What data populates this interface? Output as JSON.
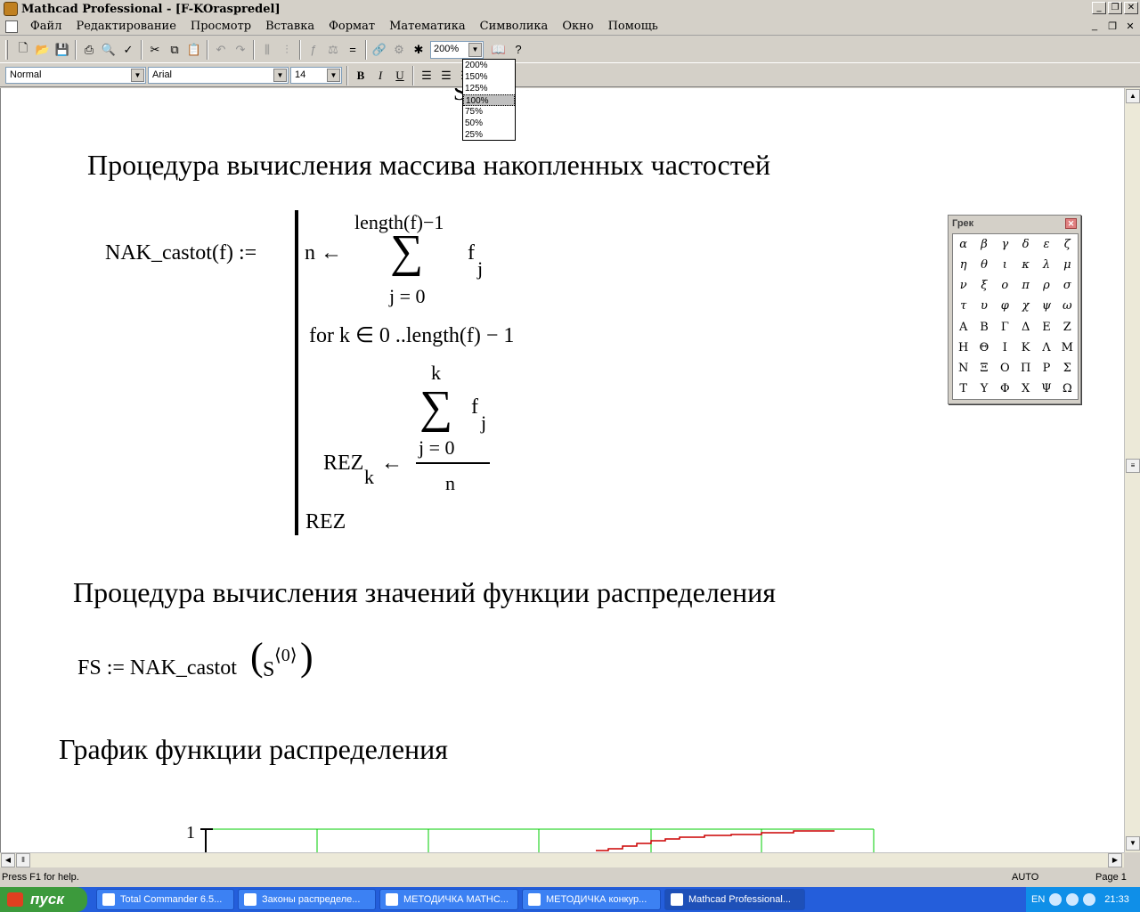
{
  "window": {
    "title": "Mathcad Professional - [F-KOraspredel]"
  },
  "menu": [
    "Файл",
    "Редактирование",
    "Просмотр",
    "Вставка",
    "Формат",
    "Математика",
    "Символика",
    "Окно",
    "Помощь"
  ],
  "toolbar": {
    "zoom_value": "200%"
  },
  "format": {
    "style": "Normal",
    "font": "Arial",
    "size": "14"
  },
  "zoom_options": [
    "200%",
    "150%",
    "125%",
    "100%",
    "75%",
    "50%",
    "25%"
  ],
  "zoom_highlighted": "100%",
  "sheet": {
    "header1": "Процедура вычисления массива накопленных частостей",
    "def_lhs": "NAK_castot(f) :=",
    "n_arrow": "n ←",
    "sum1_upper": "length(f)−1",
    "sum_symbol": "∑",
    "sum1_lower": "j = 0",
    "f_var": "f",
    "j_sub": "j",
    "for_line": "for  k ∈ 0 ..length(f) − 1",
    "sum2_upper": "k",
    "sum2_lower": "j = 0",
    "rez_lhs": "REZ",
    "k_sub": "k",
    "left_arrow": "←",
    "denominator": "n",
    "rez_last": "REZ",
    "header2": "Процедура вычисления  значений функции распределения",
    "fs_lhs": "FS := NAK_castot",
    "fs_arg": "S",
    "fs_sup": "⟨0⟩",
    "header3": "График функции распределения",
    "graph_ytick": "1"
  },
  "greek_palette": {
    "title": "Грек",
    "letters": [
      "α",
      "β",
      "γ",
      "δ",
      "ε",
      "ζ",
      "η",
      "θ",
      "ι",
      "κ",
      "λ",
      "μ",
      "ν",
      "ξ",
      "ο",
      "π",
      "ρ",
      "σ",
      "τ",
      "υ",
      "φ",
      "χ",
      "ψ",
      "ω",
      "Α",
      "Β",
      "Γ",
      "Δ",
      "Ε",
      "Ζ",
      "Η",
      "Θ",
      "Ι",
      "Κ",
      "Λ",
      "Μ",
      "Ν",
      "Ξ",
      "Ο",
      "Π",
      "Ρ",
      "Σ",
      "Τ",
      "Υ",
      "Φ",
      "Χ",
      "Ψ",
      "Ω"
    ]
  },
  "status": {
    "help": "Press F1 for help.",
    "mode": "AUTO",
    "page": "Page 1"
  },
  "taskbar": {
    "start": "пуск",
    "tasks": [
      "Total Commander 6.5...",
      "Законы распределе...",
      "МЕТОДИЧКА MATHC...",
      "МЕТОДИЧКА конкур...",
      "Mathcad Professional..."
    ],
    "lang": "EN",
    "clock": "21:33"
  }
}
